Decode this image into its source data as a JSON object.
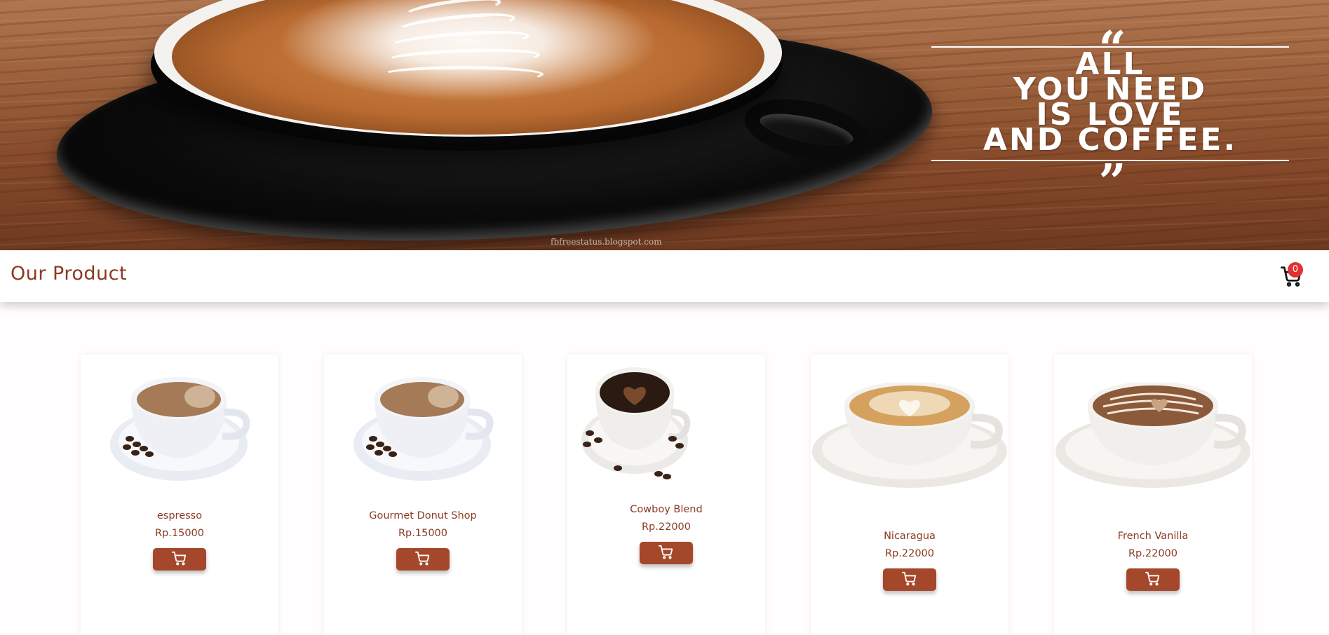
{
  "hero": {
    "quote": [
      "ALL",
      "YOU NEED",
      "IS LOVE",
      "AND COFFEE."
    ],
    "open_quote": "“",
    "close_quote": "”",
    "watermark": "fbfreestatus.blogspot.com"
  },
  "navbar": {
    "title": "Our Product",
    "cart_count": "0",
    "cart_icon": "shopping-cart-icon"
  },
  "products": [
    {
      "name": "espresso",
      "price": "Rp.15000",
      "image": "espresso-cup"
    },
    {
      "name": "Gourmet Donut Shop",
      "price": "Rp.15000",
      "image": "espresso-cup"
    },
    {
      "name": "Cowboy Blend",
      "price": "Rp.22000",
      "image": "heart-coffee-cup"
    },
    {
      "name": "Nicaragua",
      "price": "Rp.22000",
      "image": "latte-cup"
    },
    {
      "name": "French Vanilla",
      "price": "Rp.22000",
      "image": "mocha-cup"
    }
  ],
  "colors": {
    "brand": "#8b3a22",
    "button": "#a5472b",
    "badge": "#e03232"
  }
}
